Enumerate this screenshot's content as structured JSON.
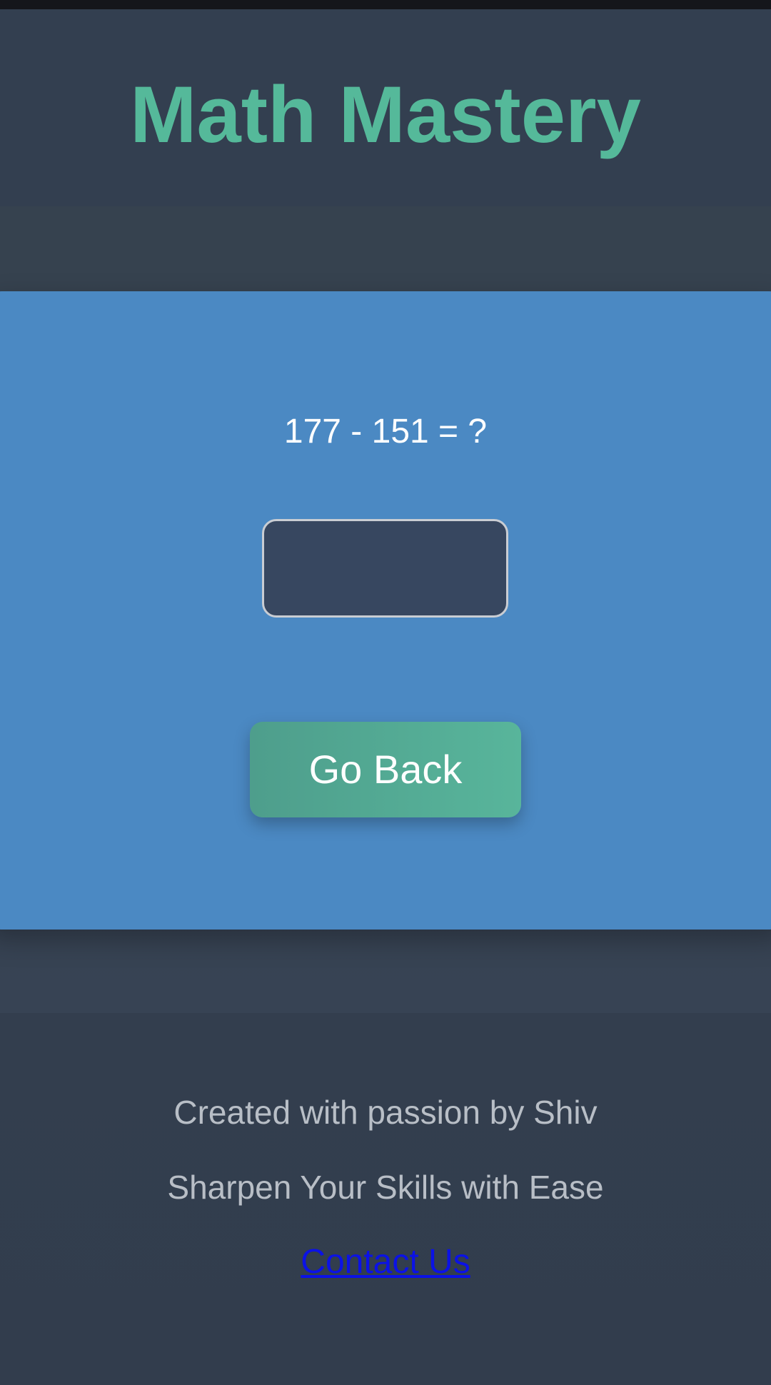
{
  "app": {
    "title": "Math Mastery"
  },
  "quiz": {
    "question": "177 - 151 = ?",
    "answer_value": "",
    "answer_placeholder": "",
    "go_back_label": "Go Back"
  },
  "footer": {
    "credit": "Created with passion by Shiv",
    "tagline": "Sharpen Your Skills with Ease",
    "contact_label": "Contact Us"
  },
  "colors": {
    "title_accent": "#55b99a",
    "card_background": "#4b89c3",
    "button_background": "#55b09a",
    "link": "#0b12e6",
    "page_background": "#34404f"
  }
}
